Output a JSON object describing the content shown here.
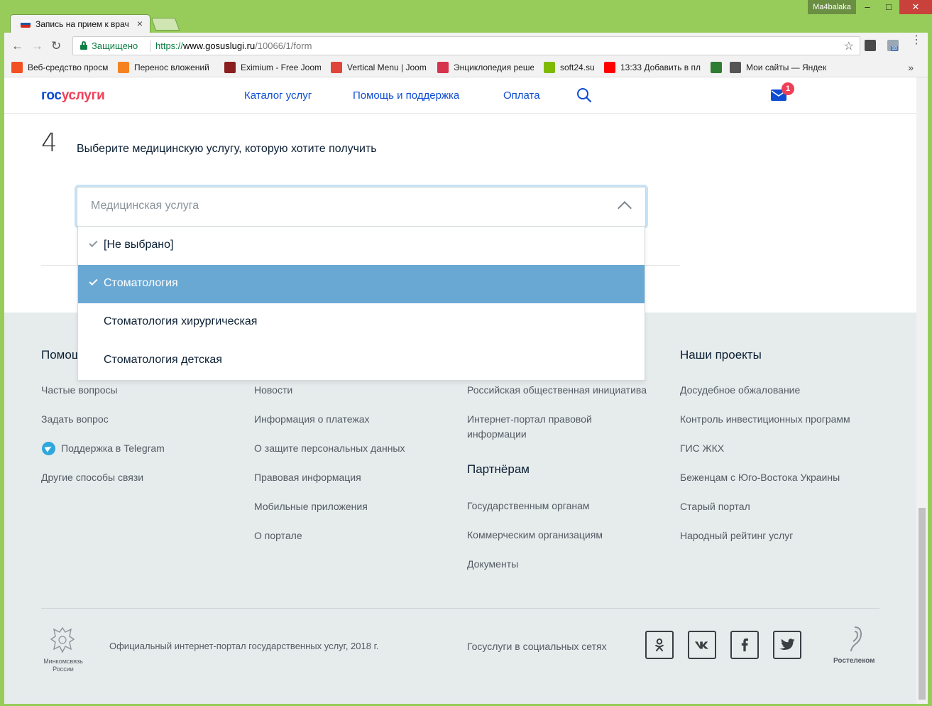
{
  "browser": {
    "tab_title": "Запись на прием к врач",
    "tab_close": "×",
    "user_badge": "Ma4balaka",
    "window_controls": {
      "minimize": "–",
      "maximize": "□",
      "close": "✕"
    },
    "nav": {
      "back": "←",
      "forward": "→",
      "reload": "↻"
    },
    "secure_label": "Защищено",
    "url_scheme": "https://",
    "url_host": "www.gosuslugi.ru",
    "url_path": "/10066/1/form",
    "star": "☆",
    "ext_badge": "18",
    "bookmarks": [
      {
        "label": "Веб-средство просм",
        "icon": "ms-icon",
        "color": "#f25022"
      },
      {
        "label": "Перенос вложений",
        "icon": "joomla-icon",
        "color": "#f58220"
      },
      {
        "label": "Eximium - Free Jooml",
        "icon": "eximium-icon",
        "color": "#8b1e1e"
      },
      {
        "label": "Vertical Menu | Joom",
        "icon": "chrome-icon",
        "color": "#e0453a"
      },
      {
        "label": "Энциклопедия реше",
        "icon": "encyclopedia-icon",
        "color": "#d6334c"
      },
      {
        "label": "soft24.su",
        "icon": "ms-icon",
        "color": "#7fba00"
      },
      {
        "label": "13:33 Добавить в пл",
        "icon": "youtube-icon",
        "color": "#ff0000"
      },
      {
        "label": "",
        "icon": "page-icon",
        "color": "#2e7d32"
      },
      {
        "label": "Мои сайты — Яндек",
        "icon": "code-icon",
        "color": "#555555"
      }
    ],
    "bookmarks_more": "»"
  },
  "header": {
    "logo_gos": "гос",
    "logo_uslugi": "услуги",
    "nav": [
      "Каталог услуг",
      "Помощь и поддержка",
      "Оплата"
    ],
    "mail_count": "1"
  },
  "form": {
    "step_number": "4",
    "step_title": "Выберите медицинскую услугу, которую хотите получить",
    "select_placeholder": "Медицинская услуга",
    "options": [
      {
        "label": "[Не выбрано]",
        "checked": true,
        "selected": false
      },
      {
        "label": "Стоматология",
        "checked": true,
        "selected": true
      },
      {
        "label": "Стоматология хирургическая",
        "checked": false,
        "selected": false
      },
      {
        "label": "Стоматология детская",
        "checked": false,
        "selected": false
      }
    ]
  },
  "footer": {
    "col1": {
      "heading": "Помощ",
      "links": [
        "Частые вопросы",
        "Задать вопрос",
        "Поддержка в Telegram",
        "Другие способы связи"
      ]
    },
    "col2": {
      "links": [
        "Новости",
        "Информация о платежах",
        "О защите персональных данных",
        "Правовая информация",
        "Мобильные приложения",
        "О портале"
      ]
    },
    "col3": {
      "links": [
        "Российская общественная инициатива",
        "Интернет-портал правовой",
        "информации"
      ],
      "partners_heading": "Партнёрам",
      "partners_links": [
        "Государственным органам",
        "Коммерческим организациям",
        "Документы"
      ]
    },
    "col4": {
      "heading": "Наши проекты",
      "links": [
        "Досудебное обжалование",
        "Контроль инвестиционных программ",
        "ГИС ЖКХ",
        "Беженцам с Юго-Востока Украины",
        "Старый портал",
        "Народный рейтинг услуг"
      ]
    },
    "emblem_line1": "Минкомсвязь",
    "emblem_line2": "России",
    "copyright": "Официальный интернет-портал государственных услуг, 2018 г.",
    "social_label": "Госуслуги в социальных сетях",
    "social": [
      {
        "name": "odnoklassniki",
        "glyph": "ok"
      },
      {
        "name": "vkontakte",
        "glyph": "vk"
      },
      {
        "name": "facebook",
        "glyph": "f"
      },
      {
        "name": "twitter",
        "glyph": "t"
      }
    ],
    "rostelecom": "Ростелеком"
  },
  "colors": {
    "brand_blue": "#0d4cd3",
    "brand_red": "#ee3f58",
    "selected_option": "#6aa8d4",
    "footer_bg": "#e6ebec"
  }
}
